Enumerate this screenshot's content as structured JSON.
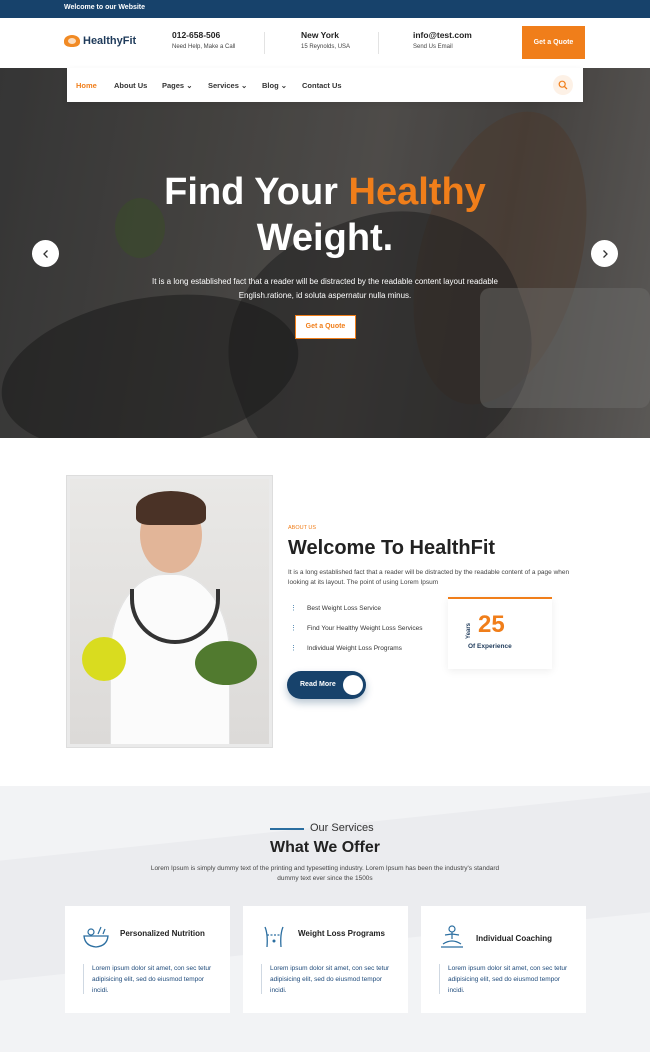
{
  "topbar": {
    "welcome": "Welcome to our Website"
  },
  "header": {
    "logo": "HealthyFit",
    "phone": {
      "title": "012-658-506",
      "sub": "Need Help, Make a Call"
    },
    "location": {
      "title": "New York",
      "sub": "15 Reynolds, USA"
    },
    "email": {
      "title": "info@test.com",
      "sub": "Send Us Email"
    },
    "quote_button": "Get a Quote"
  },
  "nav": {
    "items": [
      {
        "label": "Home",
        "active": true
      },
      {
        "label": "About Us"
      },
      {
        "label": "Pages",
        "dropdown": true
      },
      {
        "label": "Services",
        "dropdown": true
      },
      {
        "label": "Blog",
        "dropdown": true
      },
      {
        "label": "Contact Us"
      }
    ],
    "chevron": "⌄"
  },
  "hero": {
    "title_line1_a": "Find Your ",
    "title_line1_b": "Healthy",
    "title_line2": "Weight.",
    "text": "It is a long established fact that a reader will be distracted by the readable content layout readable English.ratione, id soluta aspernatur nulla minus.",
    "button": "Get a Quote"
  },
  "about": {
    "tag": "ABOUT US",
    "title": "Welcome To HealthFit",
    "text": "It is a long established fact that a reader will be distracted by the readable content of a page when looking at its layout. The point of using Lorem Ipsum",
    "features": [
      "Best Weight Loss Service",
      "Find Your Healthy Weight Loss Services",
      "Individual Weight Loss Programs"
    ],
    "experience": {
      "years_label": "Years",
      "number": "25",
      "label": "Of Experience"
    },
    "read_more": "Read More"
  },
  "services": {
    "tag": "Our Services",
    "title": "What We Offer",
    "text": "Lorem Ipsum is simply dummy text of the printing and typesetting industry. Lorem Ipsum has been the industry's standard dummy text ever since the 1500s",
    "cards": [
      {
        "title": "Personalized Nutrition",
        "text": "Lorem ipsum dolor sit amet, con sec tetur adipisicing elit, sed do eiusmod tempor incidi.",
        "icon": "nutrition-icon"
      },
      {
        "title": "Weight Loss Programs",
        "text": "Lorem ipsum dolor sit amet, con sec tetur adipisicing elit, sed do eiusmod tempor incidi.",
        "icon": "weight-loss-icon"
      },
      {
        "title": "Individual Coaching",
        "text": "Lorem ipsum dolor sit amet, con sec tetur adipisicing elit, sed do eiusmod tempor incidi.",
        "icon": "coaching-icon"
      }
    ]
  },
  "colors": {
    "primary": "#17426b",
    "accent": "#f07e1a"
  }
}
